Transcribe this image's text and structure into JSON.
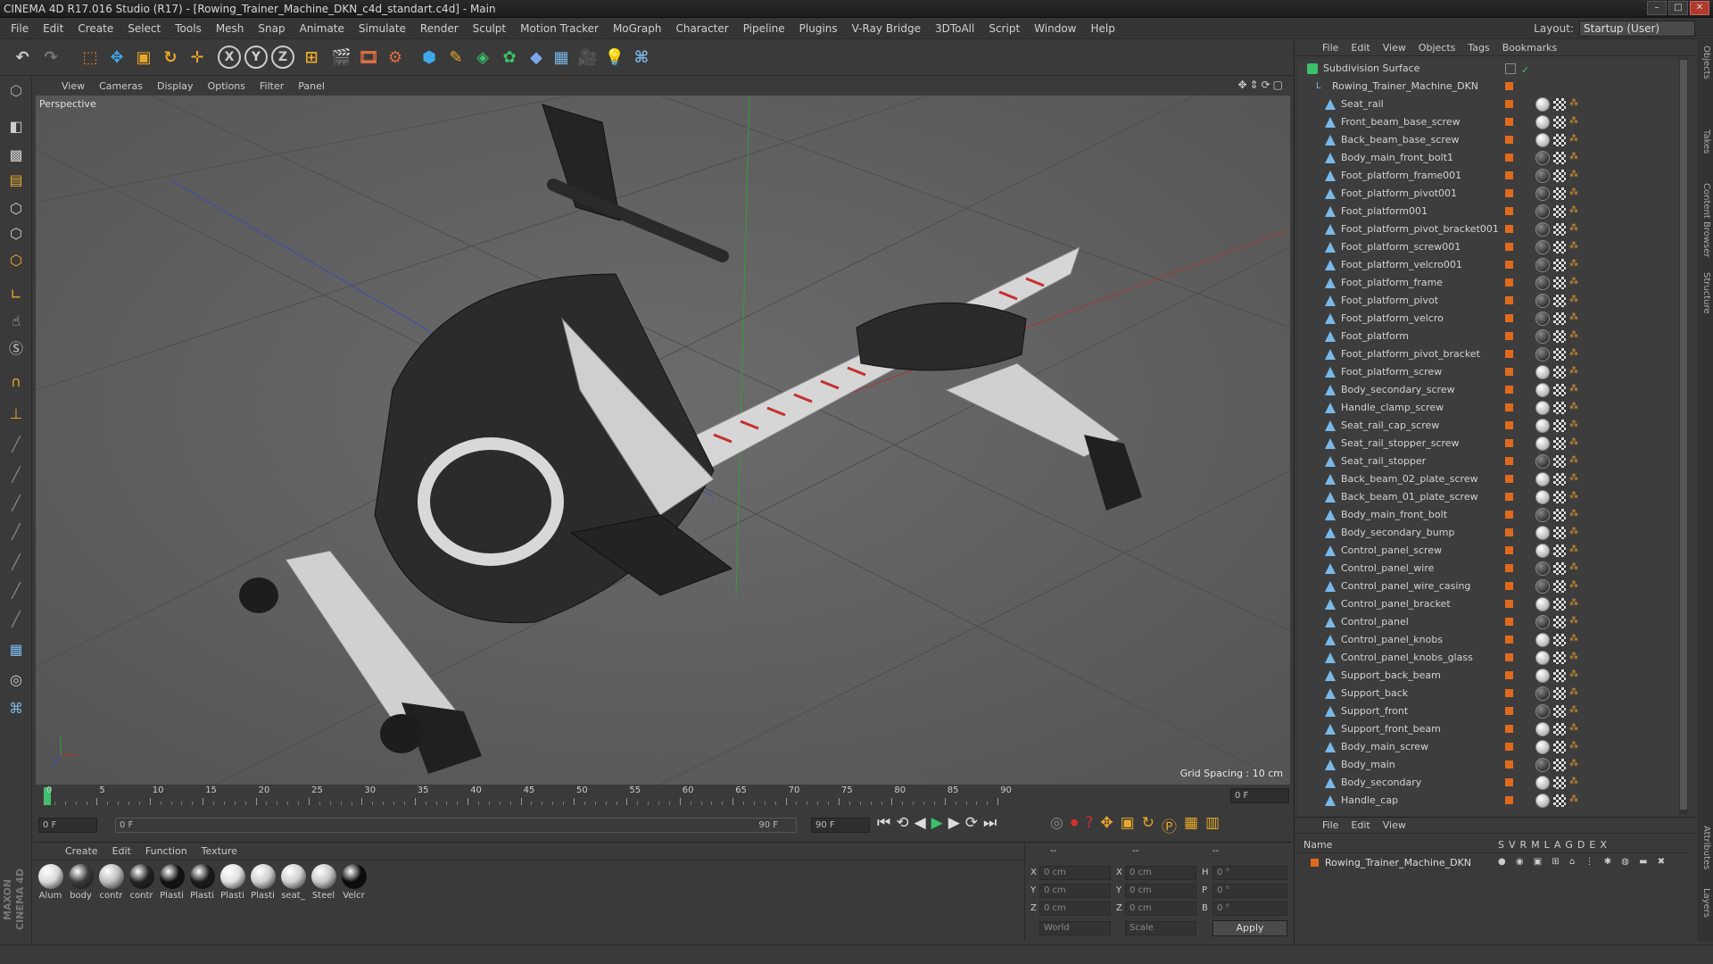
{
  "window": {
    "title": "CINEMA 4D R17.016 Studio (R17) - [Rowing_Trainer_Machine_DKN_c4d_standart.c4d] - Main"
  },
  "menubar": {
    "items": [
      "File",
      "Edit",
      "Create",
      "Select",
      "Tools",
      "Mesh",
      "Snap",
      "Animate",
      "Simulate",
      "Render",
      "Sculpt",
      "Motion Tracker",
      "MoGraph",
      "Character",
      "Pipeline",
      "Plugins",
      "V-Ray Bridge",
      "3DToAll",
      "Script",
      "Window",
      "Help"
    ]
  },
  "layout": {
    "label": "Layout:",
    "value": "Startup (User)"
  },
  "viewport": {
    "menu": [
      "View",
      "Cameras",
      "Display",
      "Options",
      "Filter",
      "Panel"
    ],
    "label": "Perspective",
    "grid_spacing": "Grid Spacing : 10 cm"
  },
  "timeline": {
    "ticks": [
      "0",
      "5",
      "10",
      "15",
      "20",
      "25",
      "30",
      "35",
      "40",
      "45",
      "50",
      "55",
      "60",
      "65",
      "70",
      "75",
      "80",
      "85",
      "90"
    ],
    "current_frame": "0 F",
    "start_field": "0 F",
    "range_start": "0 F",
    "range_end": "90 F",
    "end_field": "90 F"
  },
  "materials": {
    "menu": [
      "Create",
      "Edit",
      "Function",
      "Texture"
    ],
    "items": [
      {
        "label": "Alum",
        "color": "#d8d8d8"
      },
      {
        "label": "body",
        "color": "#3a3a3a"
      },
      {
        "label": "contr",
        "color": "#bbbbbb"
      },
      {
        "label": "contr",
        "color": "#222222"
      },
      {
        "label": "Plasti",
        "color": "#111111"
      },
      {
        "label": "Plasti",
        "color": "#1a1a1a"
      },
      {
        "label": "Plasti",
        "color": "#e0e0e0"
      },
      {
        "label": "Plasti",
        "color": "#cfcfcf"
      },
      {
        "label": "seat_",
        "color": "#d0d0d0"
      },
      {
        "label": "Steel",
        "color": "#c8c8c8"
      },
      {
        "label": "Velcr",
        "color": "#0a0a0a"
      }
    ]
  },
  "coords": {
    "header": [
      "--",
      "--",
      "--"
    ],
    "rows": [
      {
        "a": "X",
        "av": "0 cm",
        "b": "X",
        "bv": "0 cm",
        "c": "H",
        "cv": "0 °"
      },
      {
        "a": "Y",
        "av": "0 cm",
        "b": "Y",
        "bv": "0 cm",
        "c": "P",
        "cv": "0 °"
      },
      {
        "a": "Z",
        "av": "0 cm",
        "b": "Z",
        "bv": "0 cm",
        "c": "B",
        "cv": "0 °"
      }
    ],
    "mode1": "World",
    "mode2": "Scale",
    "apply": "Apply"
  },
  "objects": {
    "menu": [
      "File",
      "Edit",
      "View",
      "Objects",
      "Tags",
      "Bookmarks"
    ],
    "root": "Subdivision Surface",
    "group": "Rowing_Trainer_Machine_DKN",
    "items": [
      "Seat_rail",
      "Front_beam_base_screw",
      "Back_beam_base_screw",
      "Body_main_front_bolt1",
      "Foot_platform_frame001",
      "Foot_platform_pivot001",
      "Foot_platform001",
      "Foot_platform_pivot_bracket001",
      "Foot_platform_screw001",
      "Foot_platform_velcro001",
      "Foot_platform_frame",
      "Foot_platform_pivot",
      "Foot_platform_velcro",
      "Foot_platform",
      "Foot_platform_pivot_bracket",
      "Foot_platform_screw",
      "Body_secondary_screw",
      "Handle_clamp_screw",
      "Seat_rail_cap_screw",
      "Seat_rail_stopper_screw",
      "Seat_rail_stopper",
      "Back_beam_02_plate_screw",
      "Back_beam_01_plate_screw",
      "Body_main_front_bolt",
      "Body_secondary_bump",
      "Control_panel_screw",
      "Control_panel_wire",
      "Control_panel_wire_casing",
      "Control_panel_bracket",
      "Control_panel",
      "Control_panel_knobs",
      "Control_panel_knobs_glass",
      "Support_back_beam",
      "Support_back",
      "Support_front",
      "Support_front_beam",
      "Body_main_screw",
      "Body_main",
      "Body_secondary",
      "Handle_cap"
    ]
  },
  "layers": {
    "menu": [
      "File",
      "Edit",
      "View"
    ],
    "name_col": "Name",
    "flags": [
      "S",
      "V",
      "R",
      "M",
      "L",
      "A",
      "G",
      "D",
      "E",
      "X"
    ],
    "row": "Rowing_Trainer_Machine_DKN"
  },
  "side_tabs": [
    "Objects",
    "Takes",
    "Content Browser",
    "Structure",
    "Attributes",
    "Layers"
  ],
  "brand": "MAXON CINEMA 4D",
  "colors": {
    "accent_orange": "#e06a1c",
    "viewport_bg": "#5f5f5f",
    "panel_bg": "#3a3a3a"
  }
}
